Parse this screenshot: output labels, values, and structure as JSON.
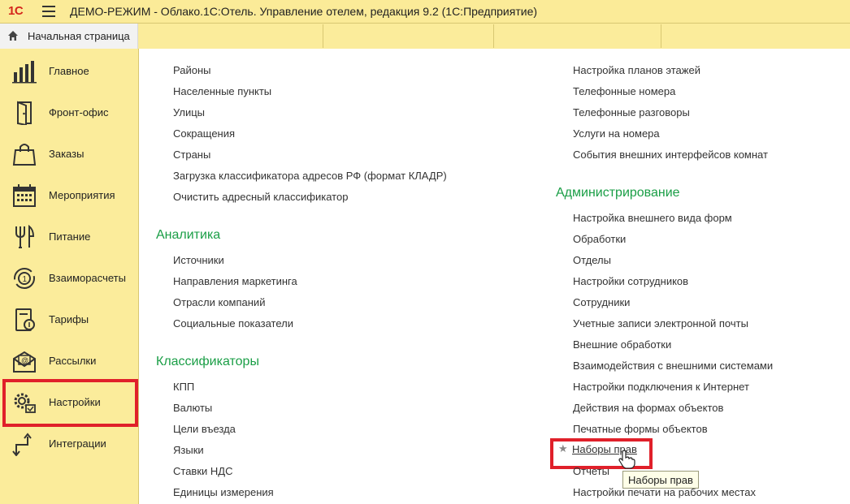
{
  "titlebar": {
    "logo": "1С",
    "title": "ДЕМО-РЕЖИМ - Облако.1С:Отель. Управление отелем, редакция 9.2  (1С:Предприятие)"
  },
  "home_tab": {
    "label": "Начальная страница"
  },
  "sidebar": {
    "items": [
      {
        "label": "Главное",
        "icon": "bar-chart-icon"
      },
      {
        "label": "Фронт-офис",
        "icon": "door-icon"
      },
      {
        "label": "Заказы",
        "icon": "shopping-bag-icon"
      },
      {
        "label": "Мероприятия",
        "icon": "calendar-icon"
      },
      {
        "label": "Питание",
        "icon": "cutlery-icon"
      },
      {
        "label": "Взаиморасчеты",
        "icon": "settlement-cycle-icon"
      },
      {
        "label": "Тарифы",
        "icon": "tariff-document-icon"
      },
      {
        "label": "Рассылки",
        "icon": "mail-envelope-icon"
      },
      {
        "label": "Настройки",
        "icon": "settings-gears-icon"
      },
      {
        "label": "Интеграции",
        "icon": "integration-arrows-icon"
      }
    ],
    "selected": "Настройки"
  },
  "content": {
    "left_column": {
      "top_links": [
        "Районы",
        "Населенные пункты",
        "Улицы",
        "Сокращения",
        "Страны",
        "Загрузка классификатора адресов РФ (формат КЛАДР)",
        "Очистить адресный классификатор"
      ],
      "analytics": {
        "title": "Аналитика",
        "links": [
          "Источники",
          "Направления маркетинга",
          "Отрасли компаний",
          "Социальные показатели"
        ]
      },
      "classifiers": {
        "title": "Классификаторы",
        "links": [
          "КПП",
          "Валюты",
          "Цели въезда",
          "Языки",
          "Ставки НДС",
          "Единицы измерения"
        ]
      }
    },
    "right_column": {
      "top_links": [
        "Настройка планов этажей",
        "Телефонные номера",
        "Телефонные разговоры",
        "Услуги на номера",
        "События внешних интерфейсов комнат"
      ],
      "administration": {
        "title": "Администрирование",
        "links": [
          "Настройка внешнего вида форм",
          "Обработки",
          "Отделы",
          "Настройки сотрудников",
          "Сотрудники",
          "Учетные записи электронной почты",
          "Внешние обработки",
          "Взаимодействия с внешними системами",
          "Настройки подключения к Интернет",
          "Действия на формах объектов",
          "Печатные формы объектов"
        ],
        "highlighted_link": "Наборы прав",
        "after_links": [
          "Отчеты",
          "Настройки печати на рабочих местах"
        ]
      }
    },
    "tooltip": "Наборы прав"
  },
  "colors": {
    "panel": "#fbec9b",
    "group_title": "#1a9e46",
    "highlight": "#e0202a",
    "logo": "#d4261c"
  }
}
